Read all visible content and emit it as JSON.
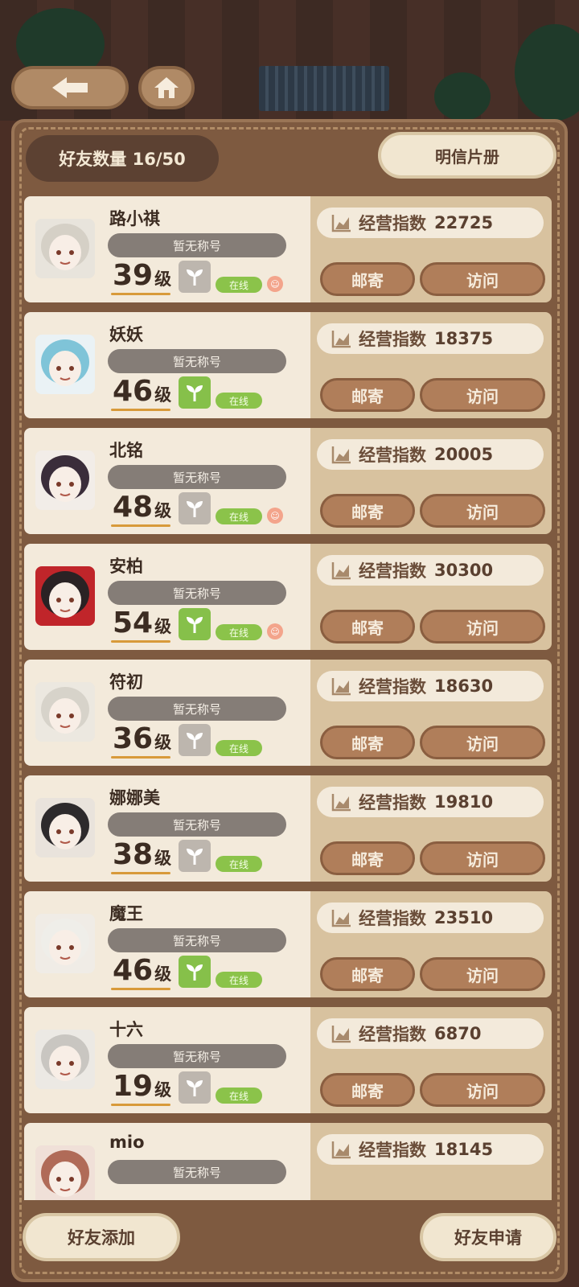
{
  "header": {
    "friend_count_label": "好友数量 16/50",
    "postcard_label": "明信片册"
  },
  "friends": [
    {
      "name": "路小祺",
      "title": "暂无称号",
      "level": "39",
      "level_unit": "级",
      "plant": "gray",
      "online": "在线",
      "emote": true,
      "score_label": "经营指数",
      "score": "22725",
      "mail": "邮寄",
      "visit": "访问",
      "avatar_color": "#e8e4dc",
      "hair": "#d5d0c6"
    },
    {
      "name": "妖妖",
      "title": "暂无称号",
      "level": "46",
      "level_unit": "级",
      "plant": "green",
      "online": "在线",
      "emote": false,
      "score_label": "经营指数",
      "score": "18375",
      "mail": "邮寄",
      "visit": "访问",
      "avatar_color": "#eaf2f5",
      "hair": "#7fc4d8"
    },
    {
      "name": "北铭",
      "title": "暂无称号",
      "level": "48",
      "level_unit": "级",
      "plant": "gray",
      "online": "在线",
      "emote": true,
      "score_label": "经营指数",
      "score": "20005",
      "mail": "邮寄",
      "visit": "访问",
      "avatar_color": "#f2ede8",
      "hair": "#3a2d3a"
    },
    {
      "name": "安柏",
      "title": "暂无称号",
      "level": "54",
      "level_unit": "级",
      "plant": "green",
      "online": "在线",
      "emote": true,
      "score_label": "经营指数",
      "score": "30300",
      "mail": "邮寄",
      "visit": "访问",
      "avatar_color": "#c0252a",
      "hair": "#2a2224"
    },
    {
      "name": "符初",
      "title": "暂无称号",
      "level": "36",
      "level_unit": "级",
      "plant": "gray",
      "online": "在线",
      "emote": false,
      "score_label": "经营指数",
      "score": "18630",
      "mail": "邮寄",
      "visit": "访问",
      "avatar_color": "#ece8e0",
      "hair": "#d7d3ca"
    },
    {
      "name": "娜娜美",
      "title": "暂无称号",
      "level": "38",
      "level_unit": "级",
      "plant": "gray",
      "online": "在线",
      "emote": false,
      "score_label": "经营指数",
      "score": "19810",
      "mail": "邮寄",
      "visit": "访问",
      "avatar_color": "#e9e3dc",
      "hair": "#2d2a2c"
    },
    {
      "name": "魔王",
      "title": "暂无称号",
      "level": "46",
      "level_unit": "级",
      "plant": "green",
      "online": "在线",
      "emote": false,
      "score_label": "经营指数",
      "score": "23510",
      "mail": "邮寄",
      "visit": "访问",
      "avatar_color": "#f0ece6",
      "hair": "#efeee9"
    },
    {
      "name": "十六",
      "title": "暂无称号",
      "level": "19",
      "level_unit": "级",
      "plant": "gray",
      "online": "在线",
      "emote": false,
      "score_label": "经营指数",
      "score": "6870",
      "mail": "邮寄",
      "visit": "访问",
      "avatar_color": "#ece9e4",
      "hair": "#c9c6c1"
    },
    {
      "name": "mio",
      "title": "暂无称号",
      "level": "",
      "level_unit": "",
      "plant": "",
      "online": "",
      "emote": false,
      "score_label": "经营指数",
      "score": "18145",
      "mail": "",
      "visit": "",
      "avatar_color": "#f0e0d8",
      "hair": "#b06b58"
    }
  ],
  "footer": {
    "add_friend_label": "好友添加",
    "friend_request_label": "好友申请"
  },
  "icons": {
    "back": "arrow-left-icon",
    "home": "home-icon",
    "plant": "sprout-icon",
    "chart": "chart-icon",
    "emote": "face-icon"
  },
  "colors": {
    "panel": "#7e5a40",
    "row_left": "#f3eadb",
    "row_right": "#d8c29f",
    "online": "#8bc34a",
    "plant_green": "#86c04a",
    "button": "#b07e5a"
  }
}
